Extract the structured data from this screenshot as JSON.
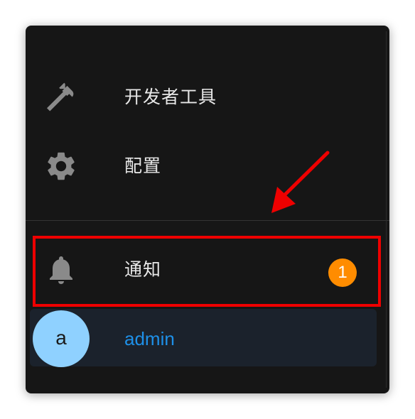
{
  "menu": {
    "items": [
      {
        "label": "开发者工具",
        "icon": "hammer-icon"
      },
      {
        "label": "配置",
        "icon": "gear-icon"
      },
      {
        "label": "通知",
        "icon": "bell-icon",
        "badge": "1"
      }
    ]
  },
  "user": {
    "avatar_letter": "a",
    "name": "admin"
  },
  "colors": {
    "panel_bg": "#161616",
    "badge": "#ff8c00",
    "avatar_bg": "#8fd1ff",
    "user_name": "#1e90e8",
    "highlight": "#ee0000"
  }
}
